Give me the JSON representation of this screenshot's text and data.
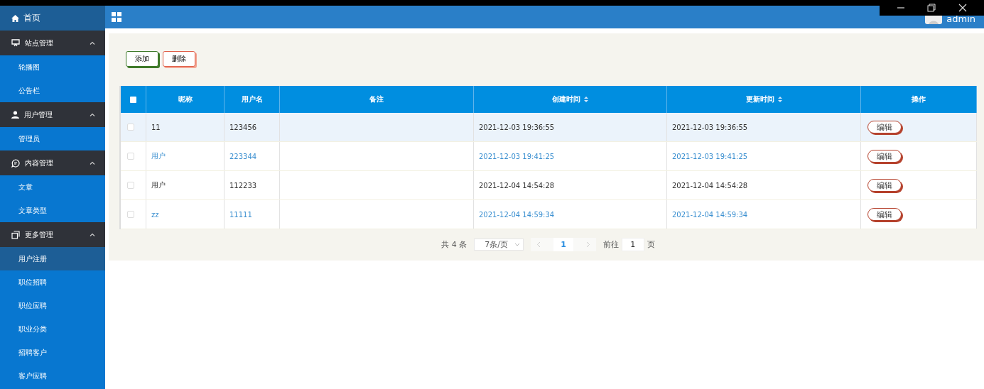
{
  "sidebar": {
    "home": {
      "label": "首页",
      "selected": true
    },
    "groups": [
      {
        "label": "站点管理",
        "kind": "screen",
        "expanded": true,
        "children": [
          {
            "label": "轮播图",
            "selected": false
          },
          {
            "label": "公告栏",
            "selected": false
          }
        ]
      },
      {
        "label": "用户管理",
        "kind": "user",
        "expanded": true,
        "children": [
          {
            "label": "管理员",
            "selected": false
          }
        ]
      },
      {
        "label": "内容管理",
        "kind": "chat",
        "expanded": true,
        "children": [
          {
            "label": "文章",
            "selected": false
          },
          {
            "label": "文章类型",
            "selected": false
          }
        ]
      },
      {
        "label": "更多管理",
        "kind": "copy",
        "expanded": true,
        "children": [
          {
            "label": "用户注册",
            "selected": true
          },
          {
            "label": "职位招聘",
            "selected": false
          },
          {
            "label": "职位应聘",
            "selected": false
          },
          {
            "label": "职业分类",
            "selected": false
          },
          {
            "label": "招聘客户",
            "selected": false
          },
          {
            "label": "客户应聘",
            "selected": false
          }
        ]
      }
    ]
  },
  "header": {
    "user": "admin"
  },
  "toolbar": {
    "buttons": [
      {
        "label": "添加",
        "kind": "add"
      },
      {
        "label": "删除",
        "kind": "delete"
      }
    ]
  },
  "table": {
    "select_all": {
      "checked": false
    },
    "columns": [
      {
        "label": "昵称",
        "sortable": false
      },
      {
        "label": "用户名",
        "sortable": false
      },
      {
        "label": "备注",
        "sortable": false
      },
      {
        "label": "创建时间",
        "sortable": true
      },
      {
        "label": "更新时间",
        "sortable": true
      },
      {
        "label": "操作",
        "sortable": false
      }
    ],
    "rows": [
      {
        "checked": false,
        "hovered": true,
        "cells": [
          "11",
          "123456",
          "",
          "2021-12-03 19:36:55",
          "2021-12-03 19:36:55"
        ],
        "action": "编辑"
      },
      {
        "checked": false,
        "hovered": false,
        "cells": [
          "用户",
          "223344",
          "",
          "2021-12-03 19:41:25",
          "2021-12-03 19:41:25"
        ],
        "action": "编辑"
      },
      {
        "checked": false,
        "hovered": false,
        "cells": [
          "用户",
          "112233",
          "",
          "2021-12-04 14:54:28",
          "2021-12-04 14:54:28"
        ],
        "action": "编辑"
      },
      {
        "checked": false,
        "hovered": false,
        "cells": [
          "zz",
          "11111",
          "",
          "2021-12-04 14:59:34",
          "2021-12-04 14:59:34"
        ],
        "action": "编辑"
      }
    ]
  },
  "pagination": {
    "total": "共 4 条",
    "page_size": "7条/页",
    "pages": [
      {
        "label": "1",
        "selected": true
      }
    ],
    "goto_label": "前往",
    "goto_value": "1",
    "goto_suffix": "页"
  }
}
